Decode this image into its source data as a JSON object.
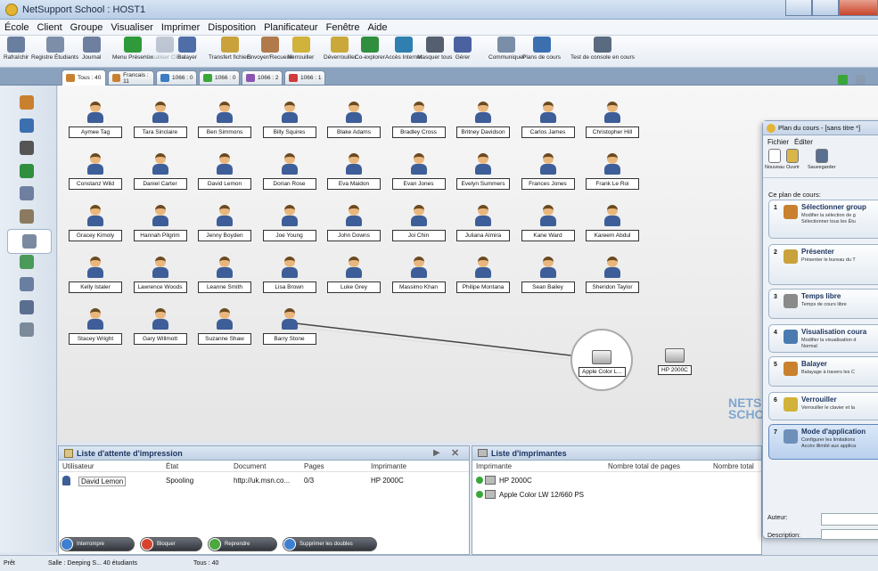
{
  "window": {
    "title": "NetSupport School : HOST1"
  },
  "menu": [
    "École",
    "Client",
    "Groupe",
    "Visualiser",
    "Imprimer",
    "Disposition",
    "Planificateur",
    "Fenêtre",
    "Aide"
  ],
  "toolbar": [
    {
      "label": "Rafraîchir",
      "icon": "refresh-icon",
      "color": "#6a7ea0",
      "disabled": false
    },
    {
      "label": "Registre Étudiants",
      "icon": "register-icon",
      "color": "#7d8fa8",
      "disabled": false
    },
    {
      "label": "Journal",
      "icon": "journal-icon",
      "color": "#6e7fa0",
      "disabled": false
    },
    {
      "label": "Menu Présenter",
      "icon": "present-icon",
      "color": "#2f9a39",
      "disabled": false
    },
    {
      "label": "Visualiser Client",
      "icon": "view-client-icon",
      "color": "#7a8aa0",
      "disabled": true
    },
    {
      "label": "Balayer",
      "icon": "scan-icon",
      "color": "#4f6ea8",
      "disabled": false
    },
    {
      "label": "Transfert fichiers",
      "icon": "file-transfer-icon",
      "color": "#c9a23b",
      "disabled": false
    },
    {
      "label": "Envoyer/Recueillir",
      "icon": "send-collect-icon",
      "color": "#b07a4a",
      "disabled": false
    },
    {
      "label": "Verrouiller",
      "icon": "lock-icon",
      "color": "#d1b23a",
      "disabled": false
    },
    {
      "label": "Déverrouiller",
      "icon": "unlock-icon",
      "color": "#cba83b",
      "disabled": false
    },
    {
      "label": "Co-explorer",
      "icon": "globe-icon",
      "color": "#2f8f3f",
      "disabled": false
    },
    {
      "label": "Accès Internet",
      "icon": "internet-icon",
      "color": "#2f7fb0",
      "disabled": false
    },
    {
      "label": "Masquer tous",
      "icon": "monitor-icon",
      "color": "#555f70",
      "disabled": false
    },
    {
      "label": "Gérer",
      "icon": "manage-icon",
      "color": "#4a63a0",
      "disabled": false
    },
    {
      "label": "Communiquer",
      "icon": "communicate-icon",
      "color": "#7a8ea8",
      "disabled": false
    },
    {
      "label": "Plans de cours",
      "icon": "lesson-plan-icon",
      "color": "#3c6fb0",
      "disabled": false
    },
    {
      "label": "Test de console en cours",
      "icon": "test-console-icon",
      "color": "#5a6a80",
      "disabled": false
    }
  ],
  "tabs": [
    {
      "label": "Tous : 40",
      "color": "#c9812f",
      "active": true
    },
    {
      "label": "Francais : 11",
      "color": "#c9812f",
      "active": false
    },
    {
      "label": "1066 : 0",
      "color": "#3c7cc0",
      "active": false
    },
    {
      "label": "1066 : 0",
      "color": "#3aa63a",
      "active": false
    },
    {
      "label": "1066 : 2",
      "color": "#8a54b0",
      "active": false
    },
    {
      "label": "1066 : 1",
      "color": "#d13b3b",
      "active": false
    }
  ],
  "students": [
    "Aymee Tag",
    "Tara Sinclaire",
    "Ben Simmons",
    "Billy Squires",
    "Blake Adams",
    "Bradley Cross",
    "Britney Davidson",
    "Carlos James",
    "Christopher Hill",
    "Constanz Wild",
    "Daniel Carter",
    "David Lemon",
    "Dorian Rose",
    "Eva Maidon",
    "Evan Jones",
    "Evelyn Summers",
    "Frances Jones",
    "Frank Le Roi",
    "Gracey Kimoly",
    "Hannah Pilgrim",
    "Jenny Boyden",
    "Joe Young",
    "John Downs",
    "Joi Chin",
    "Juliana Almira",
    "Kane Ward",
    "Kareem Abdul",
    "Kelly Istaler",
    "Lawrence Woods",
    "Leanne Smith",
    "Lisa Brown",
    "Luke Grey",
    "Massimo Khan",
    "Philipe Montana",
    "Sean Bailey",
    "Sheridon Taylor",
    "Stacey Wright",
    "Gary Willmott",
    "Suzanne Shaw",
    "Barry Stone"
  ],
  "printers_on_map": [
    "Apple Color L...",
    "HP 2000C"
  ],
  "watermark": "NETSUPPORT SCHOOL",
  "print_queue": {
    "title": "Liste d'attente d'impression",
    "columns": [
      "Utilisateur",
      "État",
      "Document",
      "Pages",
      "Imprimante"
    ],
    "rows": [
      [
        "David Lemon",
        "Spooling",
        "http://uk.msn.co...",
        "0/3",
        "HP 2000C"
      ]
    ]
  },
  "printer_list": {
    "title": "Liste d'imprimantes",
    "columns": [
      "Imprimante",
      "Nombre total de pages",
      "Nombre total"
    ],
    "rows": [
      "HP 2000C",
      "Apple Color LW 12/660 PS"
    ]
  },
  "actions": [
    {
      "label": "Interrompre",
      "color": "#3d7fd0"
    },
    {
      "label": "Bloquer",
      "color": "#d8432d"
    },
    {
      "label": "Reprendre",
      "color": "#4aa83c"
    },
    {
      "label": "Supprimer les doubles",
      "color": "#3d7fd0"
    }
  ],
  "status": {
    "ready": "Prêt",
    "room": "Salle : Deeping S...   40 étudiants",
    "tous": "Tous : 40"
  },
  "lesson_plan": {
    "title": "Plan du cours - [sans titre *]",
    "menu": [
      "Fichier",
      "Éditer"
    ],
    "toolbar": [
      "Nouveau",
      "Ouvrir",
      "Sauvegarder"
    ],
    "heading": "Ce plan de cours:",
    "steps": [
      {
        "n": "1",
        "title": "Sélectionner group",
        "desc1": "Modifier la sélection de g",
        "desc2": "Sélectionner tous les Étu"
      },
      {
        "n": "2",
        "title": "Présenter",
        "desc1": "Présenter le bureau du T",
        "desc2": ""
      },
      {
        "n": "3",
        "title": "Temps libre",
        "desc1": "Temps de cours libre",
        "desc2": ""
      },
      {
        "n": "4",
        "title": "Visualisation coura",
        "desc1": "Modifier la visualisation d",
        "desc2": "Normal"
      },
      {
        "n": "5",
        "title": "Balayer",
        "desc1": "Balayage à travers les C",
        "desc2": ""
      },
      {
        "n": "6",
        "title": "Verrouiller",
        "desc1": "Verrouiller le clavier et la",
        "desc2": ""
      },
      {
        "n": "7",
        "title": "Mode d'application",
        "desc1": "Configurer les limitations",
        "desc2": "Accès illimité aux applica"
      }
    ],
    "auteur_label": "Auteur:",
    "description_label": "Description:"
  },
  "sidebar": [
    "classroom-icon",
    "monitor-icon",
    "headset-icon",
    "globe-icon",
    "notepad-icon",
    "clipboard-icon",
    "printer-icon",
    "group-icon",
    "network-icon",
    "eraser-icon",
    "sheet-icon"
  ]
}
